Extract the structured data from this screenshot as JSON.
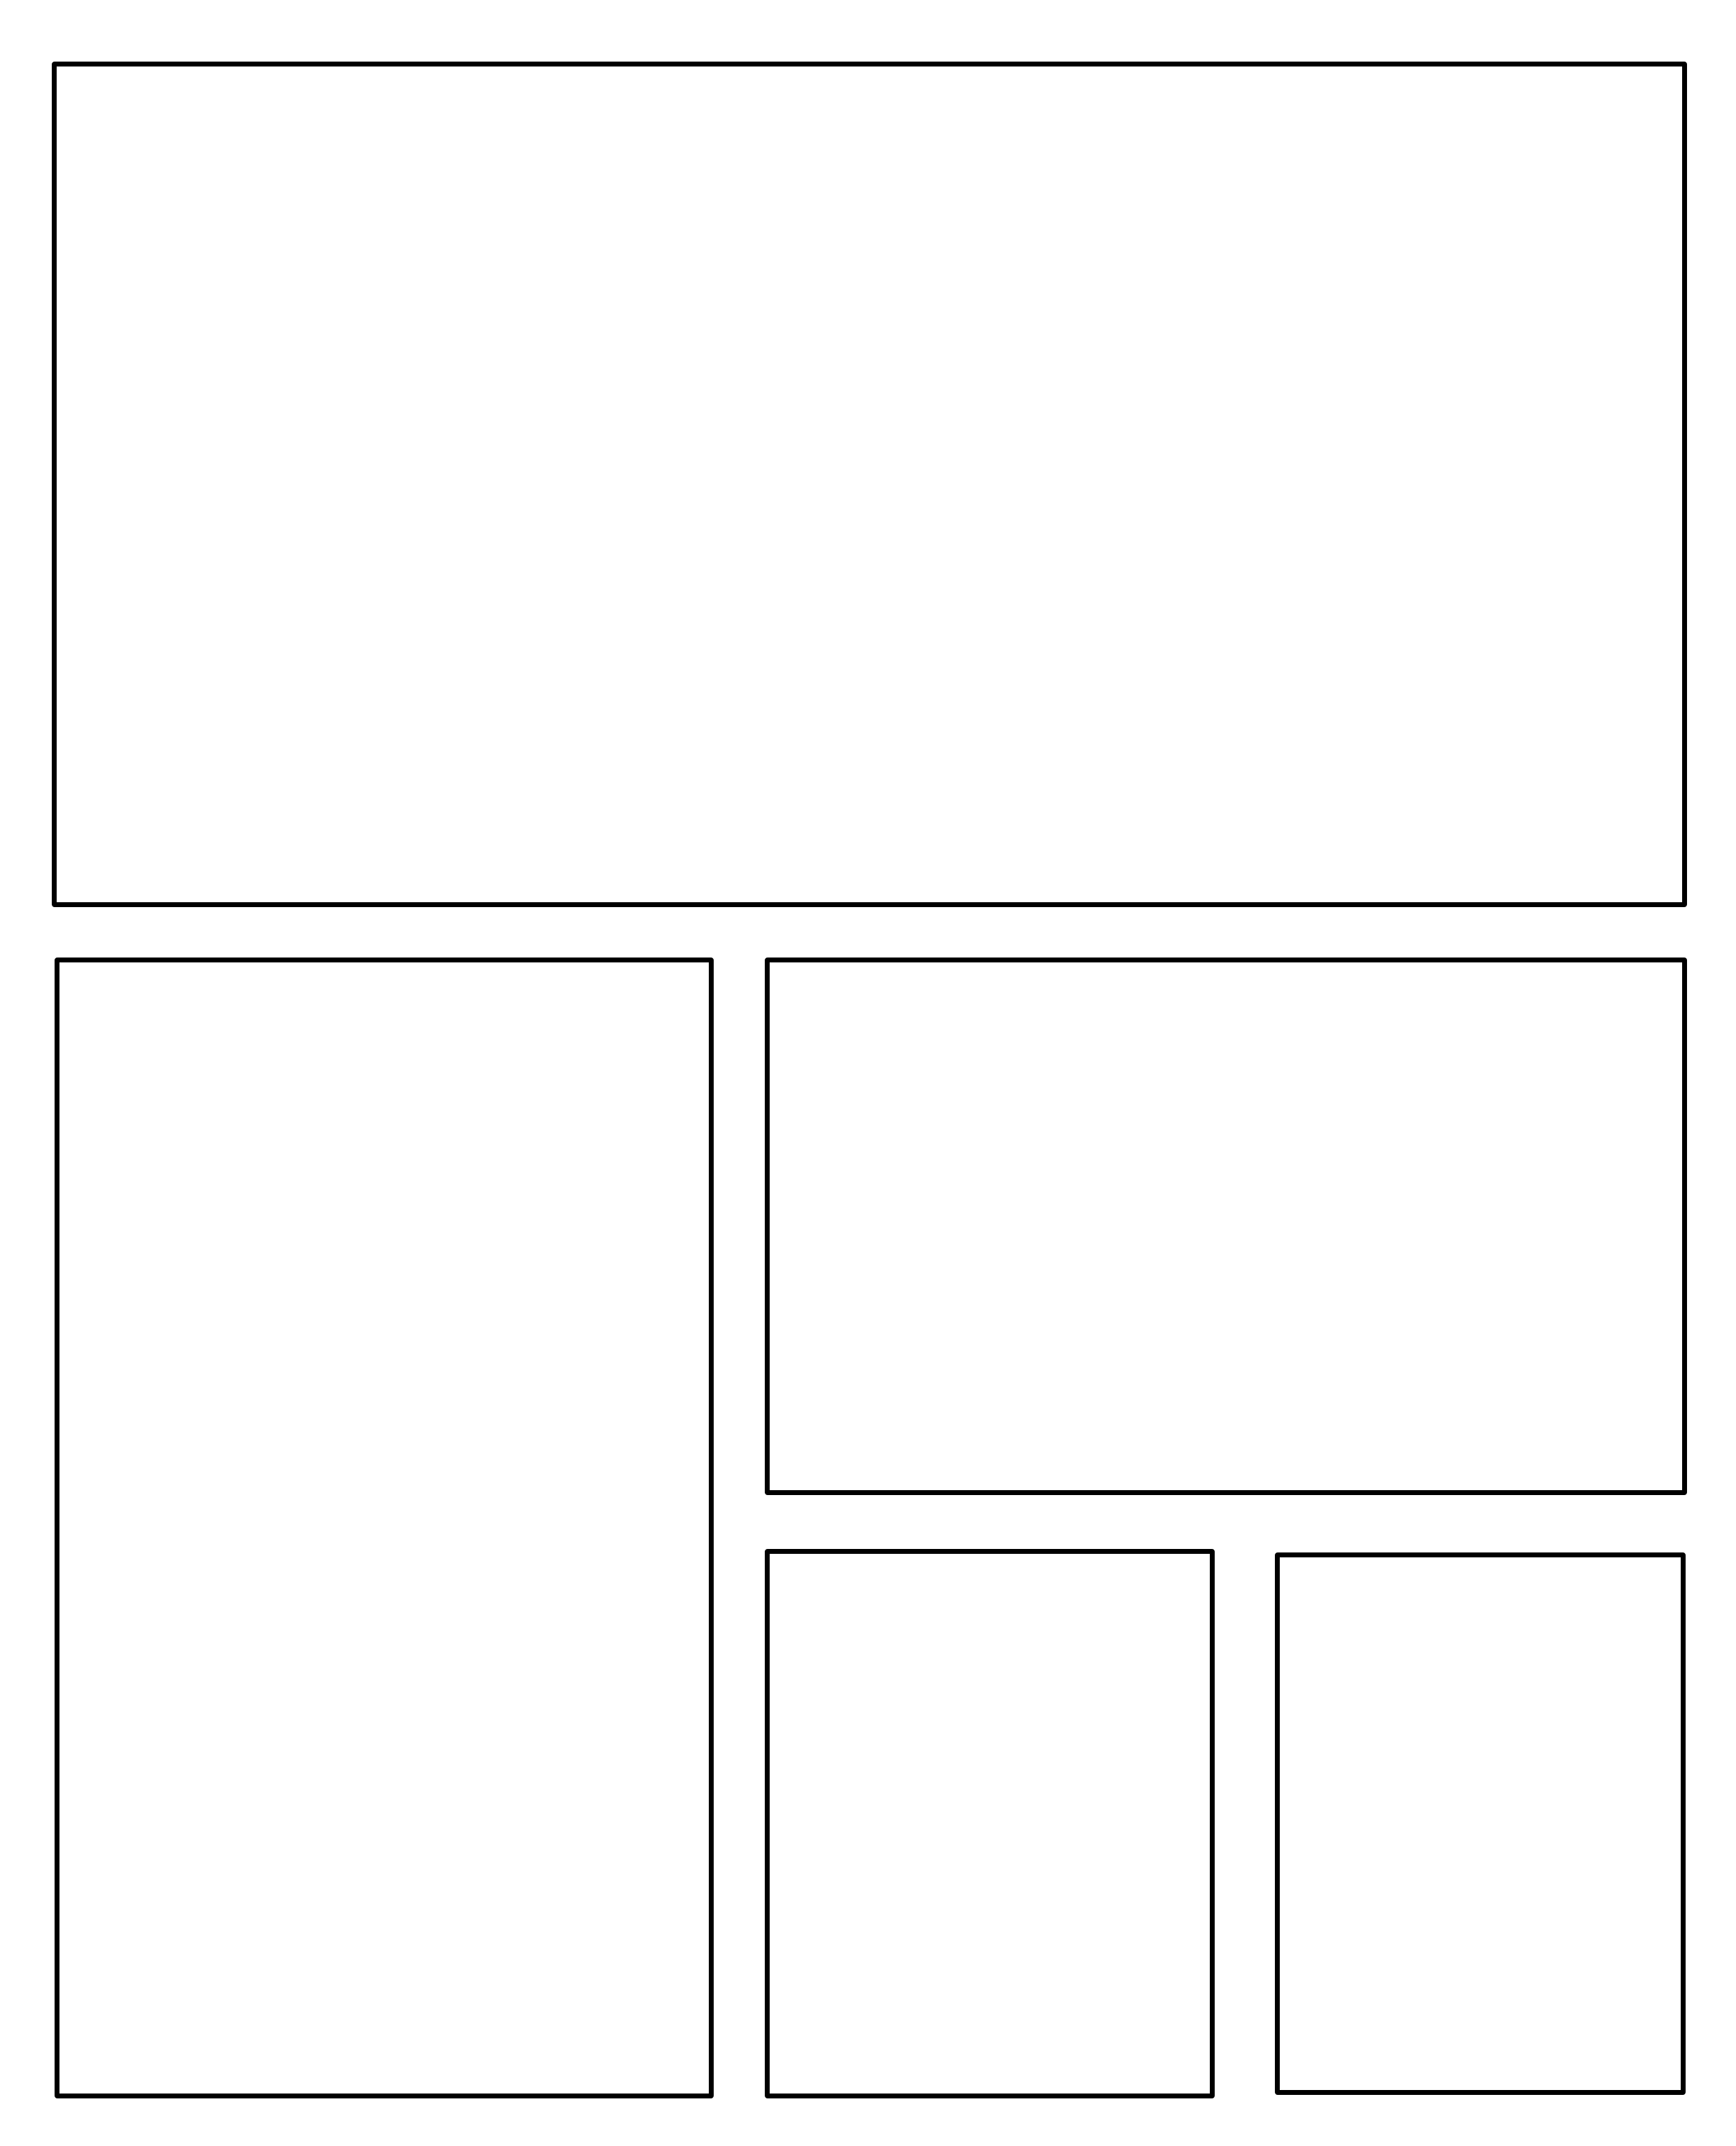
{
  "page": {
    "background_color": "#ffffff",
    "border_color": "#000000",
    "panels": [
      {
        "id": "panel-top"
      },
      {
        "id": "panel-left-tall"
      },
      {
        "id": "panel-right-wide"
      },
      {
        "id": "panel-bottom-mid"
      },
      {
        "id": "panel-bottom-right"
      }
    ]
  }
}
